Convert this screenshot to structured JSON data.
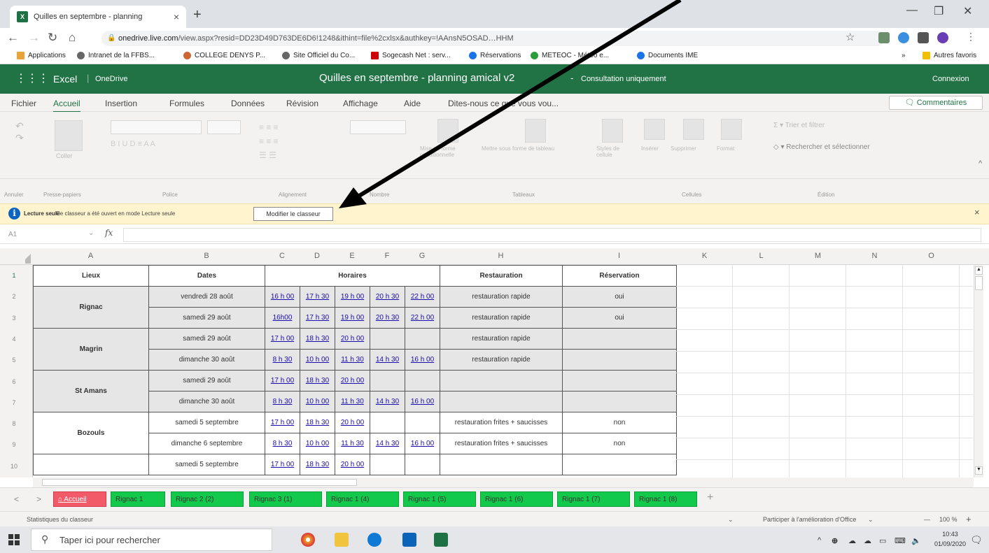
{
  "browser": {
    "tab_title": "Quilles en septembre - planning",
    "tab_close": "×",
    "new_tab": "+",
    "url_host": "onedrive.live.com",
    "url_rest": "/view.aspx?resid=DD23D49D763DE6D6!1248&ithint=file%2cxlsx&authkey=!AAnsN5OSAD…HHM",
    "bookmarks": [
      "Applications",
      "Intranet de la FFBS...",
      "COLLEGE DENYS P...",
      "Site Officiel du Co...",
      "Sogecash Net : serv...",
      "Réservations",
      "METEOC - Météo e...",
      "Documents IME"
    ],
    "bookmarks_more": "»",
    "other_bookmarks": "Autres favoris",
    "colors": {
      "tabbar": "#dee1e6",
      "excel_green": "#217346"
    }
  },
  "excel": {
    "app_name": "Excel",
    "onedrive": "OneDrive",
    "doc_title": "Quilles en septembre - planning amical v2",
    "separator": "-",
    "mode": "Consultation uniquement",
    "connexion": "Connexion",
    "menu": [
      "Fichier",
      "Accueil",
      "Insertion",
      "Formules",
      "Données",
      "Révision",
      "Affichage",
      "Aide",
      "Dites-nous ce que vous vou..."
    ],
    "comments": "Commentaires",
    "ribbon_groups": [
      "Annuler",
      "Presse-papiers",
      "Police",
      "Alignement",
      "Nombre",
      "Tableaux",
      "Cellules",
      "Édition"
    ],
    "ribbon_items": [
      "Coller",
      "Mise en forme conditionnelle",
      "Mettre sous forme de tableau",
      "Styles de cellule",
      "Insérer",
      "Supprimer",
      "Format",
      "Trier et filtrer",
      "Rechercher et sélectionner"
    ],
    "infobar": {
      "title": "Lecture seule",
      "message": "Ce classeur a été ouvert en mode Lecture seule",
      "button": "Modifier le classeur",
      "close": "×"
    },
    "namebox": "A1",
    "fx": "fx",
    "columns": [
      "A",
      "B",
      "C",
      "D",
      "E",
      "F",
      "G",
      "H",
      "I",
      "K",
      "L",
      "M",
      "N",
      "O"
    ],
    "rows": [
      "1",
      "2",
      "3",
      "4",
      "5",
      "6",
      "7",
      "8",
      "9",
      "10"
    ]
  },
  "sheet": {
    "headers": {
      "lieux": "Lieux",
      "dates": "Dates",
      "horaires": "Horaires",
      "restauration": "Restauration",
      "reservation": "Réservation"
    },
    "rows": [
      {
        "lieu": "Rignac",
        "date": "vendredi 28 août",
        "h": [
          "16 h 00",
          "17 h 30",
          "19 h 00",
          "20 h 30",
          "22 h 00"
        ],
        "resto": "restauration rapide",
        "resa": "oui"
      },
      {
        "lieu": "",
        "date": "samedi 29 août",
        "h": [
          "16h00",
          "17 h 30",
          "19 h 00",
          "20 h 30",
          "22 h 00"
        ],
        "resto": "restauration rapide",
        "resa": "oui"
      },
      {
        "lieu": "Magrin",
        "date": "samedi 29 août",
        "h": [
          "17 h 00",
          "18 h 30",
          "20 h 00",
          "",
          ""
        ],
        "resto": "restauration rapide",
        "resa": ""
      },
      {
        "lieu": "",
        "date": "dimanche 30 août",
        "h": [
          "8 h 30",
          "10 h 00",
          "11 h 30",
          "14 h 30",
          "16 h 00"
        ],
        "resto": "restauration rapide",
        "resa": ""
      },
      {
        "lieu": "St Amans",
        "date": "samedi 29 août",
        "h": [
          "17 h 00",
          "18 h 30",
          "20 h 00",
          "",
          ""
        ],
        "resto": "",
        "resa": ""
      },
      {
        "lieu": "",
        "date": "dimanche 30 août",
        "h": [
          "8 h 30",
          "10 h 00",
          "11 h 30",
          "14 h 30",
          "16 h 00"
        ],
        "resto": "",
        "resa": ""
      },
      {
        "lieu": "Bozouls",
        "date": "samedi 5 septembre",
        "h": [
          "17 h 00",
          "18 h 30",
          "20 h 00",
          "",
          ""
        ],
        "resto": "restauration frites + saucisses",
        "resa": "non"
      },
      {
        "lieu": "",
        "date": "dimanche 6 septembre",
        "h": [
          "8 h 30",
          "10 h 00",
          "11 h 30",
          "14 h 30",
          "16 h 00"
        ],
        "resto": "restauration frites + saucisses",
        "resa": "non"
      },
      {
        "lieu": "",
        "date": "samedi 5 septembre",
        "h": [
          "17 h 00",
          "18 h 30",
          "20 h 00",
          "",
          ""
        ],
        "resto": "",
        "resa": ""
      }
    ]
  },
  "sheet_tabs": {
    "active": "Accueil",
    "others": [
      "Rignac 1",
      "Rignac 2 (2)",
      "Rignac 3 (1)",
      "Rignac 1 (4)",
      "Rignac 1 (5)",
      "Rignac 1 (6)",
      "Rignac 1 (7)",
      "Rignac 1 (8)"
    ],
    "add": "+"
  },
  "statusbar": {
    "left": "Statistiques du classeur",
    "right": "Participer à l'amélioration d'Office",
    "zoom": "100 %",
    "zoom_minus": "—",
    "zoom_plus": "+"
  },
  "taskbar": {
    "search": "Taper ici pour rechercher",
    "time": "10:43",
    "date": "01/09/2020"
  }
}
